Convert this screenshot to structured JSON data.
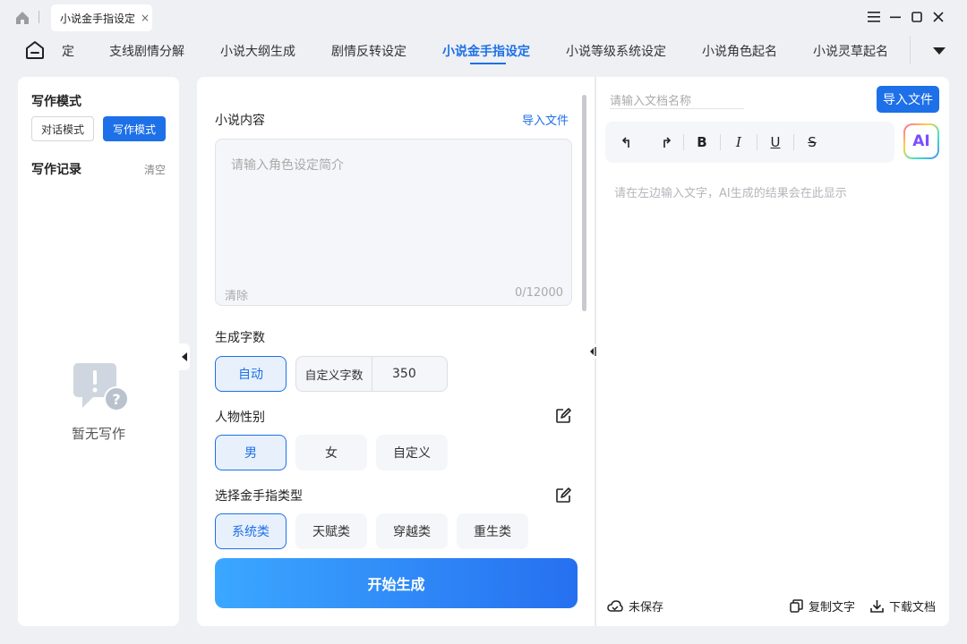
{
  "titlebar": {
    "tab_title": "小说金手指设定",
    "tab_close": "×",
    "controls": [
      "menu",
      "minimize",
      "maximize",
      "close"
    ]
  },
  "nav": {
    "items": [
      {
        "label": "定",
        "active": false
      },
      {
        "label": "支线剧情分解",
        "active": false
      },
      {
        "label": "小说大纲生成",
        "active": false
      },
      {
        "label": "剧情反转设定",
        "active": false
      },
      {
        "label": "小说金手指设定",
        "active": true
      },
      {
        "label": "小说等级系统设定",
        "active": false
      },
      {
        "label": "小说角色起名",
        "active": false
      },
      {
        "label": "小说灵草起名",
        "active": false
      }
    ],
    "accent": "#1d70e8"
  },
  "sidebar": {
    "mode_title": "写作模式",
    "mode_buttons": [
      {
        "label": "对话模式",
        "selected": false
      },
      {
        "label": "写作模式",
        "selected": true
      }
    ],
    "record_title": "写作记录",
    "clear_label": "清空",
    "empty_text": "暂无写作"
  },
  "form": {
    "content_label": "小说内容",
    "import_link": "导入文件",
    "content_placeholder": "请输入角色设定简介",
    "clear_label": "清除",
    "char_count": "0/12000",
    "length_label": "生成字数",
    "length_auto": "自动",
    "length_custom_label": "自定义字数",
    "length_custom_value": "350",
    "gender_label": "人物性别",
    "gender_options": [
      {
        "label": "男",
        "selected": true
      },
      {
        "label": "女",
        "selected": false
      },
      {
        "label": "自定义",
        "selected": false
      }
    ],
    "type_label": "选择金手指类型",
    "type_options": [
      {
        "label": "系统类",
        "selected": true
      },
      {
        "label": "天赋类",
        "selected": false
      },
      {
        "label": "穿越类",
        "selected": false
      },
      {
        "label": "重生类",
        "selected": false
      }
    ],
    "generate_button": "开始生成"
  },
  "editor": {
    "docname_placeholder": "请输入文档名称",
    "import_button": "导入文件",
    "tools": [
      "undo-icon",
      "redo-icon",
      "bold-icon",
      "italic-icon",
      "underline-icon",
      "strikethrough-icon"
    ],
    "tool_glyphs": {
      "bold": "B",
      "italic": "I",
      "underline": "U",
      "strike": "S"
    },
    "ai_label": "AI",
    "result_placeholder": "请在左边输入文字，AI生成的结果会在此显示",
    "save_status": "未保存",
    "copy_label": "复制文字",
    "download_label": "下载文档"
  }
}
